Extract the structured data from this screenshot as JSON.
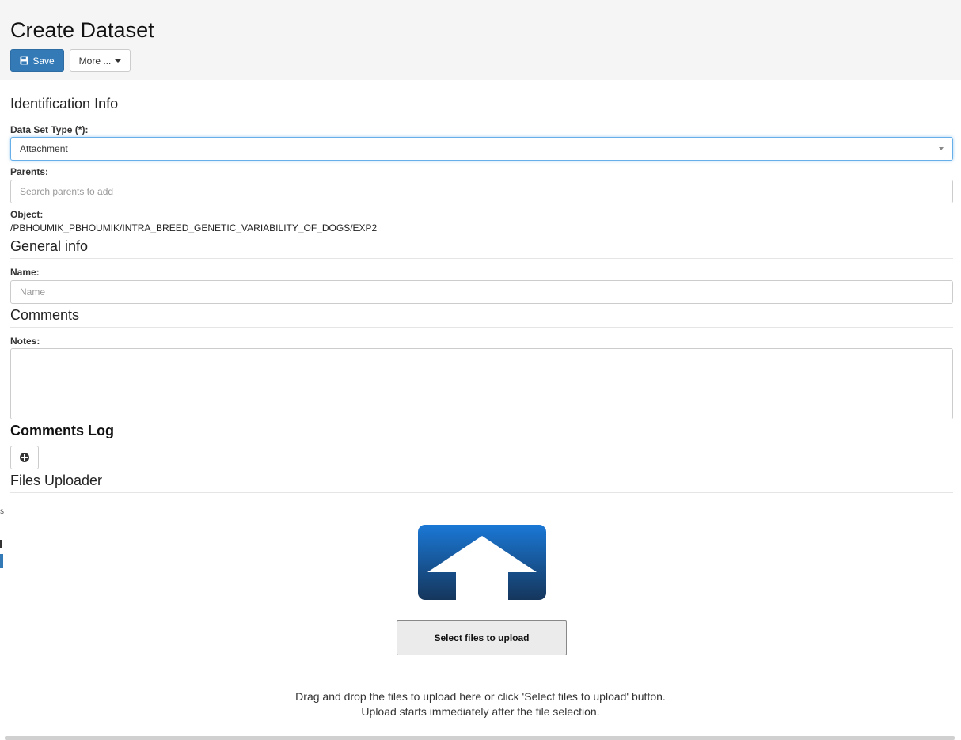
{
  "header": {
    "title": "Create Dataset",
    "save_label": "Save",
    "more_label": "More ..."
  },
  "identification": {
    "title": "Identification Info",
    "dataset_type_label": "Data Set Type (*):",
    "dataset_type_value": "Attachment",
    "parents_label": "Parents:",
    "parents_placeholder": "Search parents to add",
    "object_label": "Object:",
    "object_value": "/PBHOUMIK_PBHOUMIK/INTRA_BREED_GENETIC_VARIABILITY_OF_DOGS/EXP2"
  },
  "general": {
    "title": "General info",
    "name_label": "Name:",
    "name_placeholder": "Name"
  },
  "comments": {
    "title": "Comments",
    "notes_label": "Notes:",
    "log_title": "Comments Log"
  },
  "uploader": {
    "title": "Files Uploader",
    "select_button_label": "Select files to upload",
    "hint_line1": "Drag and drop the files to upload here or click 'Select files to upload' button.",
    "hint_line2": "Upload starts immediately after the file selection."
  },
  "colors": {
    "primary": "#337ab7",
    "header_bg": "#f5f5f5",
    "focus_border": "#66afe9",
    "upload_icon_top": "#1a78d6",
    "upload_icon_bottom": "#15365c"
  }
}
